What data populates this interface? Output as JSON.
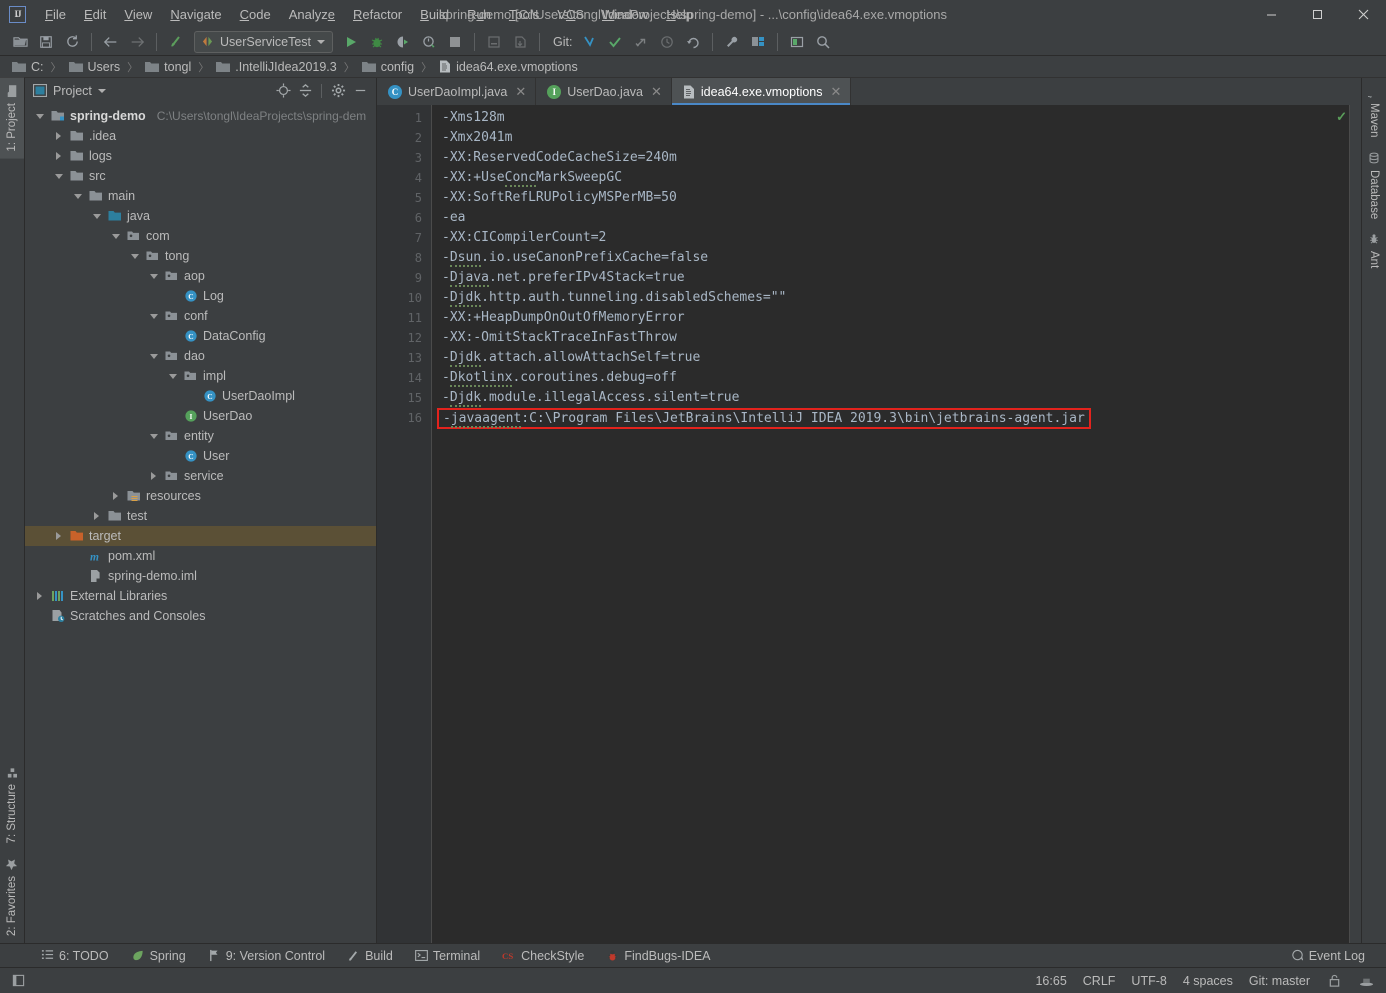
{
  "window": {
    "title": "spring-demo [C:\\Users\\tongl\\IdeaProjects\\spring-demo] - ...\\config\\idea64.exe.vmoptions",
    "logo_text": "IJ",
    "minimize": "─",
    "maximize": "☐",
    "close": "✕"
  },
  "menu": {
    "items": [
      {
        "label": "File"
      },
      {
        "label": "Edit"
      },
      {
        "label": "View"
      },
      {
        "label": "Navigate"
      },
      {
        "label": "Code"
      },
      {
        "label": "Analyze"
      },
      {
        "label": "Refactor"
      },
      {
        "label": "Build"
      },
      {
        "label": "Run"
      },
      {
        "label": "Tools"
      },
      {
        "label": "VCS"
      },
      {
        "label": "Window"
      },
      {
        "label": "Help"
      }
    ]
  },
  "toolbar": {
    "run_config": "UserServiceTest",
    "git_label": "Git:",
    "icons": [
      "open-folder-icon",
      "save-icon",
      "sync-icon",
      "back-arrow-icon",
      "forward-arrow-icon",
      "rollback-icon",
      "run-icon",
      "debug-icon",
      "run-with-coverage-icon",
      "profile-icon",
      "stop-icon",
      "build-project-icon",
      "update-project-icon",
      "git-commit-icon",
      "git-update-icon",
      "git-push-icon",
      "git-history-icon",
      "git-revert-icon",
      "settings-wrench-icon",
      "project-structure-icon",
      "window-layout-icon",
      "search-icon"
    ]
  },
  "breadcrumb": {
    "items": [
      {
        "label": "C:",
        "icon": "folder-icon"
      },
      {
        "label": "Users",
        "icon": "folder-icon"
      },
      {
        "label": "tongl",
        "icon": "folder-icon"
      },
      {
        "label": ".IntelliJIdea2019.3",
        "icon": "folder-icon"
      },
      {
        "label": "config",
        "icon": "folder-icon"
      },
      {
        "label": "idea64.exe.vmoptions",
        "icon": "file-icon"
      }
    ],
    "separator": "〉"
  },
  "left_strip": {
    "top": [
      {
        "label": "1: Project",
        "icon": "project-folder-icon",
        "active": true
      }
    ],
    "bottom": [
      {
        "label": "7: Structure",
        "icon": "structure-icon",
        "active": false
      },
      {
        "label": "2: Favorites",
        "icon": "star-icon",
        "active": false
      }
    ]
  },
  "right_strip": {
    "tabs": [
      {
        "label": "Maven",
        "icon": "maven-icon"
      },
      {
        "label": "Database",
        "icon": "database-icon"
      },
      {
        "label": "Ant",
        "icon": "ant-icon"
      }
    ]
  },
  "project_panel": {
    "title": "Project",
    "actions": [
      "locate-target-icon",
      "collapse-all-icon",
      "gear-icon",
      "hide-icon"
    ],
    "tree": [
      {
        "indent": 0,
        "twisty": "down",
        "icon": "module-icon",
        "label": "spring-demo",
        "bold": true,
        "path": "C:\\Users\\tongl\\IdeaProjects\\spring-dem",
        "selected": false
      },
      {
        "indent": 1,
        "twisty": "right",
        "icon": "folder-icon",
        "label": ".idea",
        "selected": false
      },
      {
        "indent": 1,
        "twisty": "right",
        "icon": "folder-icon",
        "label": "logs",
        "selected": false
      },
      {
        "indent": 1,
        "twisty": "down",
        "icon": "folder-icon",
        "label": "src",
        "selected": false
      },
      {
        "indent": 2,
        "twisty": "down",
        "icon": "folder-icon",
        "label": "main",
        "selected": false
      },
      {
        "indent": 3,
        "twisty": "down",
        "icon": "source-root-icon",
        "label": "java",
        "selected": false
      },
      {
        "indent": 4,
        "twisty": "down",
        "icon": "package-icon",
        "label": "com",
        "selected": false
      },
      {
        "indent": 5,
        "twisty": "down",
        "icon": "package-icon",
        "label": "tong",
        "selected": false
      },
      {
        "indent": 6,
        "twisty": "down",
        "icon": "package-icon",
        "label": "aop",
        "selected": false
      },
      {
        "indent": 7,
        "twisty": "none",
        "icon": "class-icon",
        "label": "Log",
        "selected": false
      },
      {
        "indent": 6,
        "twisty": "down",
        "icon": "package-icon",
        "label": "conf",
        "selected": false
      },
      {
        "indent": 7,
        "twisty": "none",
        "icon": "class-icon",
        "label": "DataConfig",
        "selected": false
      },
      {
        "indent": 6,
        "twisty": "down",
        "icon": "package-icon",
        "label": "dao",
        "selected": false
      },
      {
        "indent": 7,
        "twisty": "down",
        "icon": "package-icon",
        "label": "impl",
        "selected": false
      },
      {
        "indent": 8,
        "twisty": "none",
        "icon": "class-icon",
        "label": "UserDaoImpl",
        "selected": false
      },
      {
        "indent": 7,
        "twisty": "none",
        "icon": "interface-icon",
        "label": "UserDao",
        "selected": false
      },
      {
        "indent": 6,
        "twisty": "down",
        "icon": "package-icon",
        "label": "entity",
        "selected": false
      },
      {
        "indent": 7,
        "twisty": "none",
        "icon": "class-icon",
        "label": "User",
        "selected": false
      },
      {
        "indent": 6,
        "twisty": "right",
        "icon": "package-icon",
        "label": "service",
        "selected": false
      },
      {
        "indent": 4,
        "twisty": "right",
        "icon": "resources-root-icon",
        "label": "resources",
        "selected": false
      },
      {
        "indent": 3,
        "twisty": "right",
        "icon": "folder-icon",
        "label": "test",
        "selected": false
      },
      {
        "indent": 1,
        "twisty": "right",
        "icon": "excluded-folder-icon",
        "label": "target",
        "selected": true
      },
      {
        "indent": 2,
        "twisty": "none",
        "icon": "maven-file-icon",
        "label": "pom.xml",
        "selected": false
      },
      {
        "indent": 2,
        "twisty": "none",
        "icon": "iml-file-icon",
        "label": "spring-demo.iml",
        "selected": false
      },
      {
        "indent": 0,
        "twisty": "right",
        "icon": "libraries-icon",
        "label": "External Libraries",
        "selected": false
      },
      {
        "indent": 0,
        "twisty": "none",
        "icon": "scratches-icon",
        "label": "Scratches and Consoles",
        "selected": false
      }
    ]
  },
  "editor": {
    "tabs": [
      {
        "label": "UserDaoImpl.java",
        "icon": "class-icon",
        "active": false,
        "close": "✕"
      },
      {
        "label": "UserDao.java",
        "icon": "interface-icon",
        "active": false,
        "close": "✕"
      },
      {
        "label": "idea64.exe.vmoptions",
        "icon": "file-icon",
        "active": true,
        "close": "✕"
      }
    ],
    "inspection_status": "✓",
    "lines": [
      {
        "num": "1",
        "text": "-Xms128m",
        "squiggle": null,
        "boxed": false
      },
      {
        "num": "2",
        "text": "-Xmx2041m",
        "squiggle": null,
        "boxed": false
      },
      {
        "num": "3",
        "text": "-XX:ReservedCodeCacheSize=240m",
        "squiggle": null,
        "boxed": false
      },
      {
        "num": "4",
        "text": "-XX:+UseConcMarkSweepGC",
        "squiggle": "Conc",
        "boxed": false
      },
      {
        "num": "5",
        "text": "-XX:SoftRefLRUPolicyMSPerMB=50",
        "squiggle": null,
        "boxed": false
      },
      {
        "num": "6",
        "text": "-ea",
        "squiggle": null,
        "boxed": false
      },
      {
        "num": "7",
        "text": "-XX:CICompilerCount=2",
        "squiggle": null,
        "boxed": false
      },
      {
        "num": "8",
        "text": "-Dsun.io.useCanonPrefixCache=false",
        "squiggle": "Dsun",
        "boxed": false
      },
      {
        "num": "9",
        "text": "-Djava.net.preferIPv4Stack=true",
        "squiggle": "Djava",
        "boxed": false
      },
      {
        "num": "10",
        "text": "-Djdk.http.auth.tunneling.disabledSchemes=\"\"",
        "squiggle": "Djdk",
        "boxed": false
      },
      {
        "num": "11",
        "text": "-XX:+HeapDumpOnOutOfMemoryError",
        "squiggle": null,
        "boxed": false
      },
      {
        "num": "12",
        "text": "-XX:-OmitStackTraceInFastThrow",
        "squiggle": null,
        "boxed": false
      },
      {
        "num": "13",
        "text": "-Djdk.attach.allowAttachSelf=true",
        "squiggle": "Djdk",
        "boxed": false
      },
      {
        "num": "14",
        "text": "-Dkotlinx.coroutines.debug=off",
        "squiggle": "Dkotlinx",
        "boxed": false
      },
      {
        "num": "15",
        "text": "-Djdk.module.illegalAccess.silent=true",
        "squiggle": "Djdk",
        "boxed": false
      },
      {
        "num": "16",
        "text": "-javaagent:C:\\Program Files\\JetBrains\\IntelliJ IDEA 2019.3\\bin\\jetbrains-agent.jar",
        "squiggle": "javaagent",
        "boxed": true
      }
    ]
  },
  "bottom_bar": {
    "items": [
      {
        "label": "6: TODO",
        "icon": "todo-icon"
      },
      {
        "label": "Spring",
        "icon": "spring-leaf-icon"
      },
      {
        "label": "9: Version Control",
        "icon": "version-control-icon"
      },
      {
        "label": "Build",
        "icon": "build-hammer-icon"
      },
      {
        "label": "Terminal",
        "icon": "terminal-icon"
      },
      {
        "label": "CheckStyle",
        "icon": "checkstyle-icon"
      },
      {
        "label": "FindBugs-IDEA",
        "icon": "findbugs-icon"
      }
    ],
    "event_log": "Event Log"
  },
  "status_bar": {
    "caret_position": "16:65",
    "line_separator": "CRLF",
    "encoding": "UTF-8",
    "indent": "4 spaces",
    "branch": "Git: master",
    "icons": [
      "read-only-lock-icon",
      "inspection-hat-icon"
    ]
  },
  "colors": {
    "accent_blue": "#4a88c7",
    "annotation_red": "#e3231d",
    "selection_brown": "#5b5036",
    "editor_bg": "#2b2b2b",
    "panel_bg": "#3c3f41"
  }
}
